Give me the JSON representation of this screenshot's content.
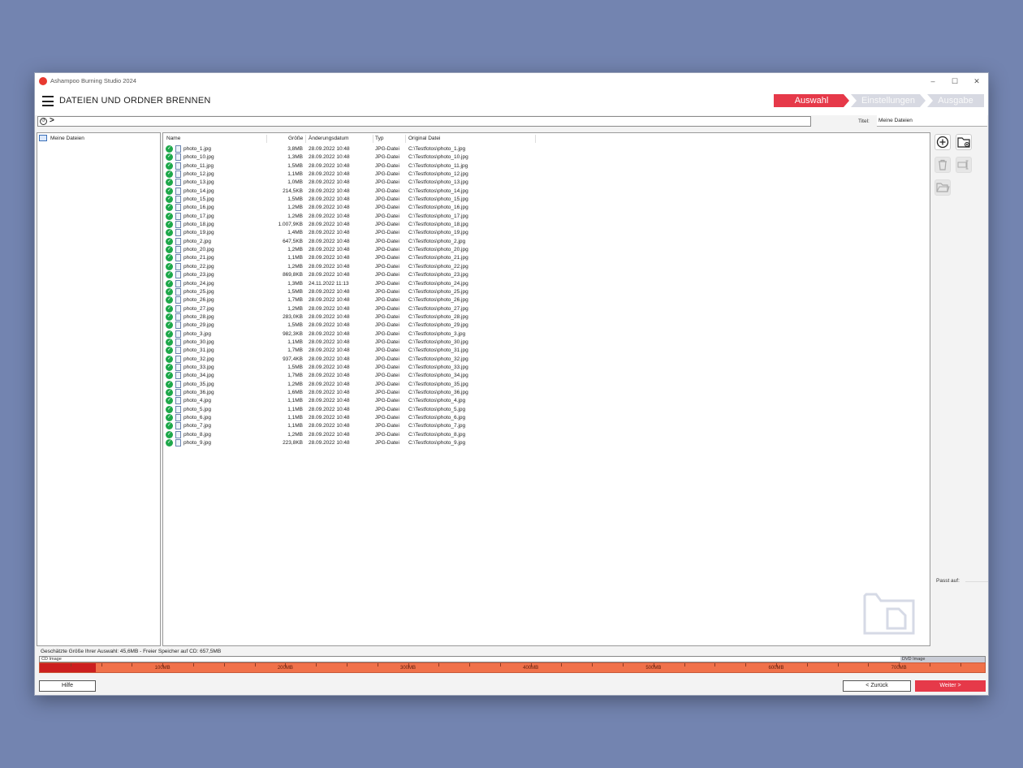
{
  "window": {
    "app_title": "Ashampoo Burning Studio 2024",
    "controls": {
      "minimize": "–",
      "maximize": "☐",
      "close": "✕"
    }
  },
  "header": {
    "page_title": "DATEIEN UND ORDNER BRENNEN",
    "steps": [
      "Auswahl",
      "Einstellungen",
      "Ausgabe"
    ],
    "active_step": "Auswahl"
  },
  "pathbar": {
    "chevron": ">"
  },
  "title_field": {
    "label": "Titel:",
    "value": "Meine Dateien"
  },
  "tree": {
    "root_label": "Meine Dateien"
  },
  "filelist": {
    "columns": [
      "Name",
      "Größe",
      "Änderungsdatum",
      "Typ",
      "Original Datei"
    ],
    "rows": [
      {
        "name": "photo_1.jpg",
        "size": "3,8MB",
        "date": "28.09.2022 10:48",
        "type": "JPG-Datei",
        "original": "C:\\Testfotos\\photo_1.jpg"
      },
      {
        "name": "photo_10.jpg",
        "size": "1,3MB",
        "date": "28.09.2022 10:48",
        "type": "JPG-Datei",
        "original": "C:\\Testfotos\\photo_10.jpg"
      },
      {
        "name": "photo_11.jpg",
        "size": "1,5MB",
        "date": "28.09.2022 10:48",
        "type": "JPG-Datei",
        "original": "C:\\Testfotos\\photo_11.jpg"
      },
      {
        "name": "photo_12.jpg",
        "size": "1,1MB",
        "date": "28.09.2022 10:48",
        "type": "JPG-Datei",
        "original": "C:\\Testfotos\\photo_12.jpg"
      },
      {
        "name": "photo_13.jpg",
        "size": "1,0MB",
        "date": "28.09.2022 10:48",
        "type": "JPG-Datei",
        "original": "C:\\Testfotos\\photo_13.jpg"
      },
      {
        "name": "photo_14.jpg",
        "size": "214,5KB",
        "date": "28.09.2022 10:48",
        "type": "JPG-Datei",
        "original": "C:\\Testfotos\\photo_14.jpg"
      },
      {
        "name": "photo_15.jpg",
        "size": "1,5MB",
        "date": "28.09.2022 10:48",
        "type": "JPG-Datei",
        "original": "C:\\Testfotos\\photo_15.jpg"
      },
      {
        "name": "photo_16.jpg",
        "size": "1,2MB",
        "date": "28.09.2022 10:48",
        "type": "JPG-Datei",
        "original": "C:\\Testfotos\\photo_16.jpg"
      },
      {
        "name": "photo_17.jpg",
        "size": "1,2MB",
        "date": "28.09.2022 10:48",
        "type": "JPG-Datei",
        "original": "C:\\Testfotos\\photo_17.jpg"
      },
      {
        "name": "photo_18.jpg",
        "size": "1.007,9KB",
        "date": "28.09.2022 10:48",
        "type": "JPG-Datei",
        "original": "C:\\Testfotos\\photo_18.jpg"
      },
      {
        "name": "photo_19.jpg",
        "size": "1,4MB",
        "date": "28.09.2022 10:48",
        "type": "JPG-Datei",
        "original": "C:\\Testfotos\\photo_19.jpg"
      },
      {
        "name": "photo_2.jpg",
        "size": "647,5KB",
        "date": "28.09.2022 10:48",
        "type": "JPG-Datei",
        "original": "C:\\Testfotos\\photo_2.jpg"
      },
      {
        "name": "photo_20.jpg",
        "size": "1,2MB",
        "date": "28.09.2022 10:48",
        "type": "JPG-Datei",
        "original": "C:\\Testfotos\\photo_20.jpg"
      },
      {
        "name": "photo_21.jpg",
        "size": "1,1MB",
        "date": "28.09.2022 10:48",
        "type": "JPG-Datei",
        "original": "C:\\Testfotos\\photo_21.jpg"
      },
      {
        "name": "photo_22.jpg",
        "size": "1,2MB",
        "date": "28.09.2022 10:48",
        "type": "JPG-Datei",
        "original": "C:\\Testfotos\\photo_22.jpg"
      },
      {
        "name": "photo_23.jpg",
        "size": "869,8KB",
        "date": "28.09.2022 10:48",
        "type": "JPG-Datei",
        "original": "C:\\Testfotos\\photo_23.jpg"
      },
      {
        "name": "photo_24.jpg",
        "size": "1,3MB",
        "date": "24.11.2022 11:13",
        "type": "JPG-Datei",
        "original": "C:\\Testfotos\\photo_24.jpg"
      },
      {
        "name": "photo_25.jpg",
        "size": "1,5MB",
        "date": "28.09.2022 10:48",
        "type": "JPG-Datei",
        "original": "C:\\Testfotos\\photo_25.jpg"
      },
      {
        "name": "photo_26.jpg",
        "size": "1,7MB",
        "date": "28.09.2022 10:48",
        "type": "JPG-Datei",
        "original": "C:\\Testfotos\\photo_26.jpg"
      },
      {
        "name": "photo_27.jpg",
        "size": "1,2MB",
        "date": "28.09.2022 10:48",
        "type": "JPG-Datei",
        "original": "C:\\Testfotos\\photo_27.jpg"
      },
      {
        "name": "photo_28.jpg",
        "size": "283,0KB",
        "date": "28.09.2022 10:48",
        "type": "JPG-Datei",
        "original": "C:\\Testfotos\\photo_28.jpg"
      },
      {
        "name": "photo_29.jpg",
        "size": "1,5MB",
        "date": "28.09.2022 10:48",
        "type": "JPG-Datei",
        "original": "C:\\Testfotos\\photo_29.jpg"
      },
      {
        "name": "photo_3.jpg",
        "size": "982,3KB",
        "date": "28.09.2022 10:48",
        "type": "JPG-Datei",
        "original": "C:\\Testfotos\\photo_3.jpg"
      },
      {
        "name": "photo_30.jpg",
        "size": "1,1MB",
        "date": "28.09.2022 10:48",
        "type": "JPG-Datei",
        "original": "C:\\Testfotos\\photo_30.jpg"
      },
      {
        "name": "photo_31.jpg",
        "size": "1,7MB",
        "date": "28.09.2022 10:48",
        "type": "JPG-Datei",
        "original": "C:\\Testfotos\\photo_31.jpg"
      },
      {
        "name": "photo_32.jpg",
        "size": "937,4KB",
        "date": "28.09.2022 10:48",
        "type": "JPG-Datei",
        "original": "C:\\Testfotos\\photo_32.jpg"
      },
      {
        "name": "photo_33.jpg",
        "size": "1,5MB",
        "date": "28.09.2022 10:48",
        "type": "JPG-Datei",
        "original": "C:\\Testfotos\\photo_33.jpg"
      },
      {
        "name": "photo_34.jpg",
        "size": "1,7MB",
        "date": "28.09.2022 10:48",
        "type": "JPG-Datei",
        "original": "C:\\Testfotos\\photo_34.jpg"
      },
      {
        "name": "photo_35.jpg",
        "size": "1,2MB",
        "date": "28.09.2022 10:48",
        "type": "JPG-Datei",
        "original": "C:\\Testfotos\\photo_35.jpg"
      },
      {
        "name": "photo_36.jpg",
        "size": "1,6MB",
        "date": "28.09.2022 10:48",
        "type": "JPG-Datei",
        "original": "C:\\Testfotos\\photo_36.jpg"
      },
      {
        "name": "photo_4.jpg",
        "size": "1,1MB",
        "date": "28.09.2022 10:48",
        "type": "JPG-Datei",
        "original": "C:\\Testfotos\\photo_4.jpg"
      },
      {
        "name": "photo_5.jpg",
        "size": "1,1MB",
        "date": "28.09.2022 10:48",
        "type": "JPG-Datei",
        "original": "C:\\Testfotos\\photo_5.jpg"
      },
      {
        "name": "photo_6.jpg",
        "size": "1,1MB",
        "date": "28.09.2022 10:48",
        "type": "JPG-Datei",
        "original": "C:\\Testfotos\\photo_6.jpg"
      },
      {
        "name": "photo_7.jpg",
        "size": "1,1MB",
        "date": "28.09.2022 10:48",
        "type": "JPG-Datei",
        "original": "C:\\Testfotos\\photo_7.jpg"
      },
      {
        "name": "photo_8.jpg",
        "size": "1,2MB",
        "date": "28.09.2022 10:48",
        "type": "JPG-Datei",
        "original": "C:\\Testfotos\\photo_8.jpg"
      },
      {
        "name": "photo_9.jpg",
        "size": "223,8KB",
        "date": "28.09.2022 10:48",
        "type": "JPG-Datei",
        "original": "C:\\Testfotos\\photo_9.jpg"
      }
    ]
  },
  "toolbar": {
    "icons": [
      "add-file-icon",
      "add-folder-icon",
      "delete-icon",
      "rename-icon",
      "open-folder-icon"
    ],
    "fits_label": "Passt auf:"
  },
  "status": {
    "text": "Geschätzte Größe Ihrer Auswahl: 45,6MB - Freier Speicher auf CD: 657,5MB"
  },
  "capacity": {
    "cd_label": "CD Image",
    "dvd_label": "DVD Image",
    "used_mb": 45.6,
    "max_mb": 770,
    "ticks": [
      "100MB",
      "200MB",
      "300MB",
      "400MB",
      "500MB",
      "600MB",
      "700MB"
    ]
  },
  "buttons": {
    "help": "Hilfe",
    "back": "< Zurück",
    "next": "Weiter >"
  },
  "colors": {
    "accent": "#e63949",
    "capacity_bar": "#f0714a",
    "capacity_used": "#cc1f1f",
    "ok": "#1ea84a"
  }
}
